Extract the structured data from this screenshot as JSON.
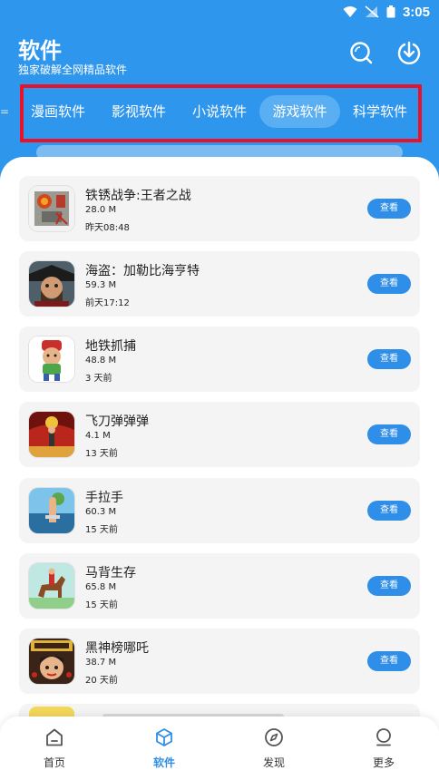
{
  "status": {
    "time": "3:05"
  },
  "header": {
    "title": "软件",
    "subtitle": "独家破解全网精品软件",
    "search_icon": "search-icon",
    "download_icon": "download-icon"
  },
  "tabs": {
    "edge": "=",
    "items": [
      {
        "label": "漫画软件",
        "active": false
      },
      {
        "label": "影视软件",
        "active": false
      },
      {
        "label": "小说软件",
        "active": false
      },
      {
        "label": "游戏软件",
        "active": true
      },
      {
        "label": "科学软件",
        "active": false
      }
    ]
  },
  "apps": [
    {
      "name": "铁锈战争:王者之战",
      "size": "28.0 M",
      "time": "昨天08:48",
      "button": "查看"
    },
    {
      "name": "海盗：加勒比海亨特",
      "size": "59.3 M",
      "time": "前天17:12",
      "button": "查看"
    },
    {
      "name": "地铁抓捕",
      "size": "48.8 M",
      "time": "3 天前",
      "button": "查看"
    },
    {
      "name": "飞刀弹弹弹",
      "size": "4.1 M",
      "time": "13 天前",
      "button": "查看"
    },
    {
      "name": "手拉手",
      "size": "60.3 M",
      "time": "15 天前",
      "button": "查看"
    },
    {
      "name": "马背生存",
      "size": "65.8 M",
      "time": "15 天前",
      "button": "查看"
    },
    {
      "name": "黑神榜哪吒",
      "size": "38.7 M",
      "time": "20 天前",
      "button": "查看"
    }
  ],
  "bottom_nav": [
    {
      "label": "首页",
      "icon": "home-icon",
      "active": false
    },
    {
      "label": "软件",
      "icon": "cube-icon",
      "active": true
    },
    {
      "label": "发现",
      "icon": "compass-icon",
      "active": false
    },
    {
      "label": "更多",
      "icon": "more-icon",
      "active": false
    }
  ],
  "colors": {
    "header_bg": "#2f96ee",
    "accent": "#2f8ee8",
    "highlight_border": "#e8132a",
    "card_bg": "#f4f4f5"
  }
}
